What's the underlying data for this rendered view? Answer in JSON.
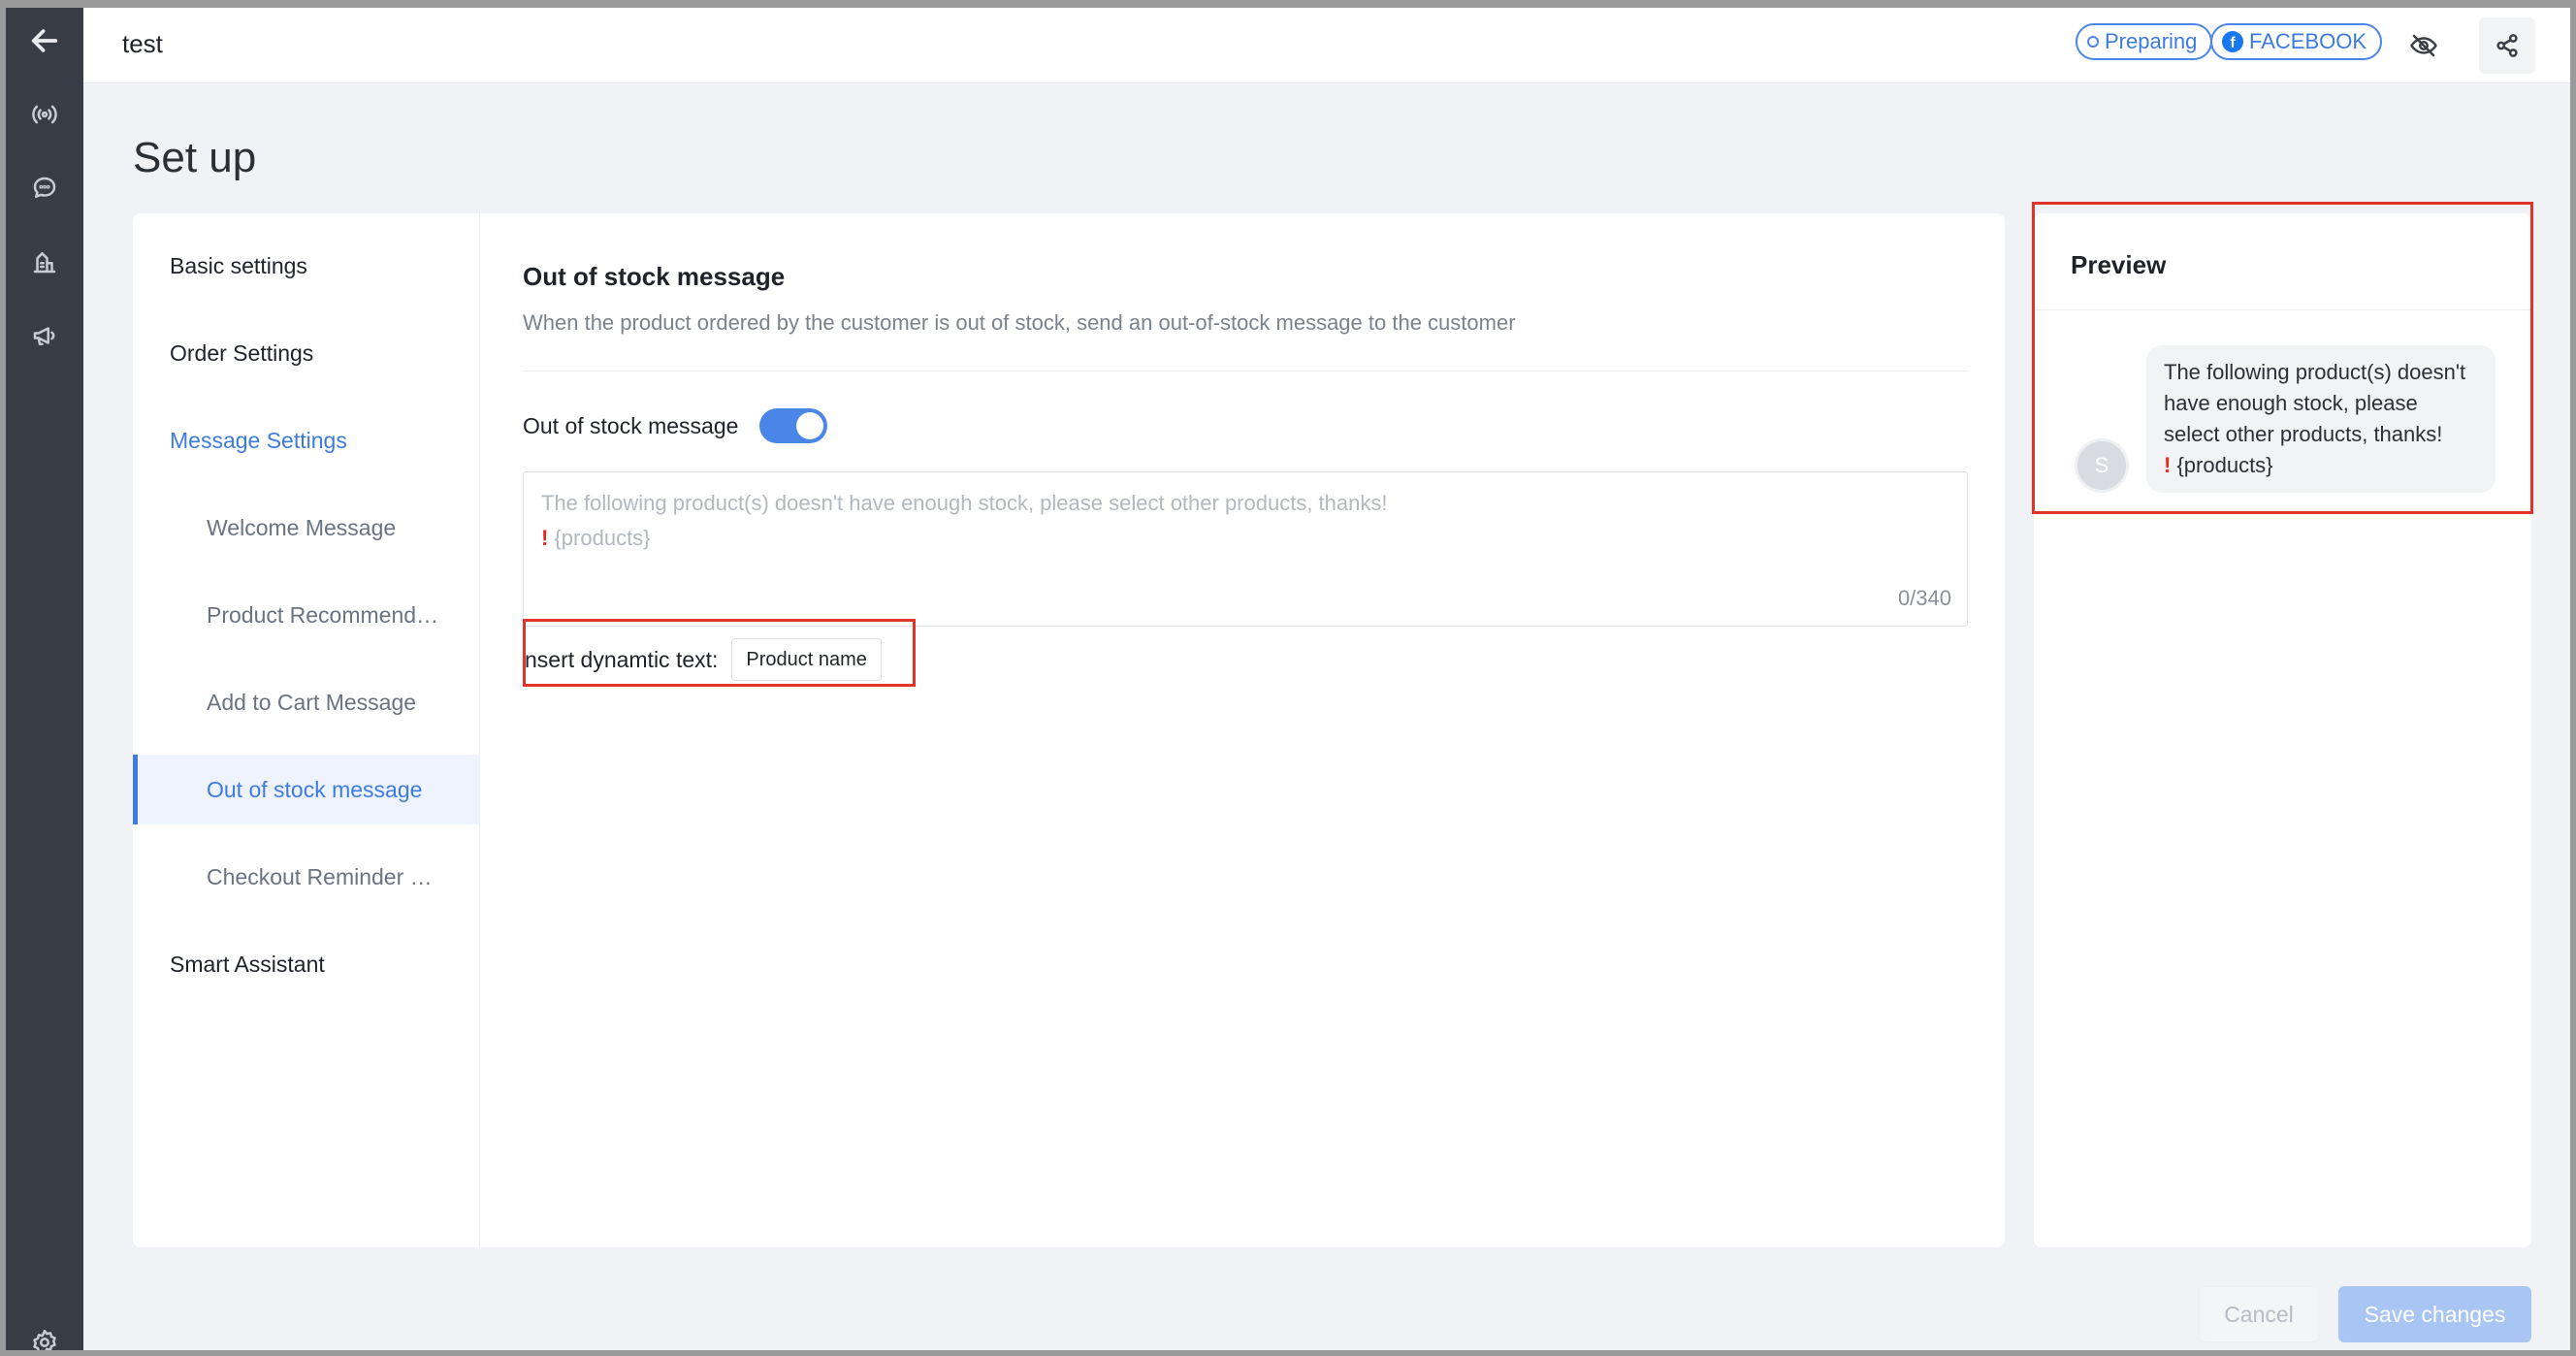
{
  "header": {
    "title": "test",
    "status_badge": "Preparing",
    "platform_badge": "FACEBOOK"
  },
  "page_title": "Set up",
  "nav": {
    "items": [
      {
        "label": "Basic settings"
      },
      {
        "label": "Order Settings"
      },
      {
        "label": "Message Settings"
      },
      {
        "label": "Welcome Message"
      },
      {
        "label": "Product Recommendation Message"
      },
      {
        "label": "Add to Cart Message"
      },
      {
        "label": "Out of stock message"
      },
      {
        "label": "Checkout Reminder Message"
      },
      {
        "label": "Smart Assistant"
      }
    ]
  },
  "section": {
    "title": "Out of stock message",
    "description": "When the product ordered by the customer is out of stock, send an out-of-stock message to the customer",
    "toggle_label": "Out of stock message",
    "toggle_on": true,
    "textarea_placeholder_line1": "The following product(s) doesn't have enough stock, please select other products, thanks!",
    "textarea_placeholder_line2": "{products}",
    "counter": "0/340",
    "insert_label": "nsert dynamtic text:",
    "insert_chip": "Product name"
  },
  "preview": {
    "title": "Preview",
    "avatar_letter": "S",
    "message_text": "The following product(s) doesn't have enough stock, please select other products, thanks!",
    "message_products": "{products}"
  },
  "footer": {
    "cancel_label": "Cancel",
    "save_label": "Save changes"
  },
  "colors": {
    "accent": "#3d7be0",
    "highlight_box": "#e0342a",
    "rail": "#383c44"
  }
}
